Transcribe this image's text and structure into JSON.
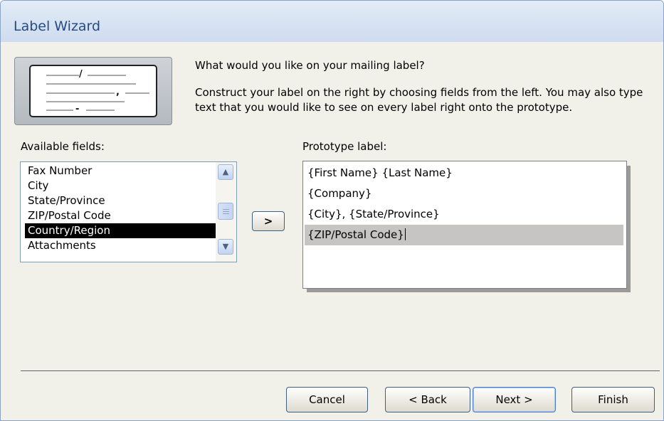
{
  "window": {
    "title": "Label Wizard"
  },
  "header": {
    "question": "What would you like on your mailing label?",
    "description": "Construct your label on the right by choosing fields from the left. You may also type text that you would like to see on every label right onto the prototype."
  },
  "available_fields": {
    "label": "Available fields:",
    "items": [
      "Fax Number",
      "City",
      "State/Province",
      "ZIP/Postal Code",
      "Country/Region",
      "Attachments"
    ],
    "selected": "Country/Region"
  },
  "move_button": {
    "label": ">"
  },
  "prototype": {
    "label": "Prototype label:",
    "lines": [
      "{First Name} {Last Name}",
      "{Company}",
      "{City}, {State/Province}",
      "{ZIP/Postal Code}",
      ""
    ]
  },
  "footer": {
    "cancel": "Cancel",
    "back": "< Back",
    "next": "Next >",
    "finish": "Finish"
  },
  "icons": {
    "scroll_up": "chevron-up-icon",
    "scroll_down": "chevron-down-icon",
    "wizard_illustration": "label-illustration-icon"
  },
  "colors": {
    "selection": "#000000",
    "active_line": "#c6c5c3",
    "dialog_bg": "#f1f0e9",
    "title_text": "#254b82"
  }
}
